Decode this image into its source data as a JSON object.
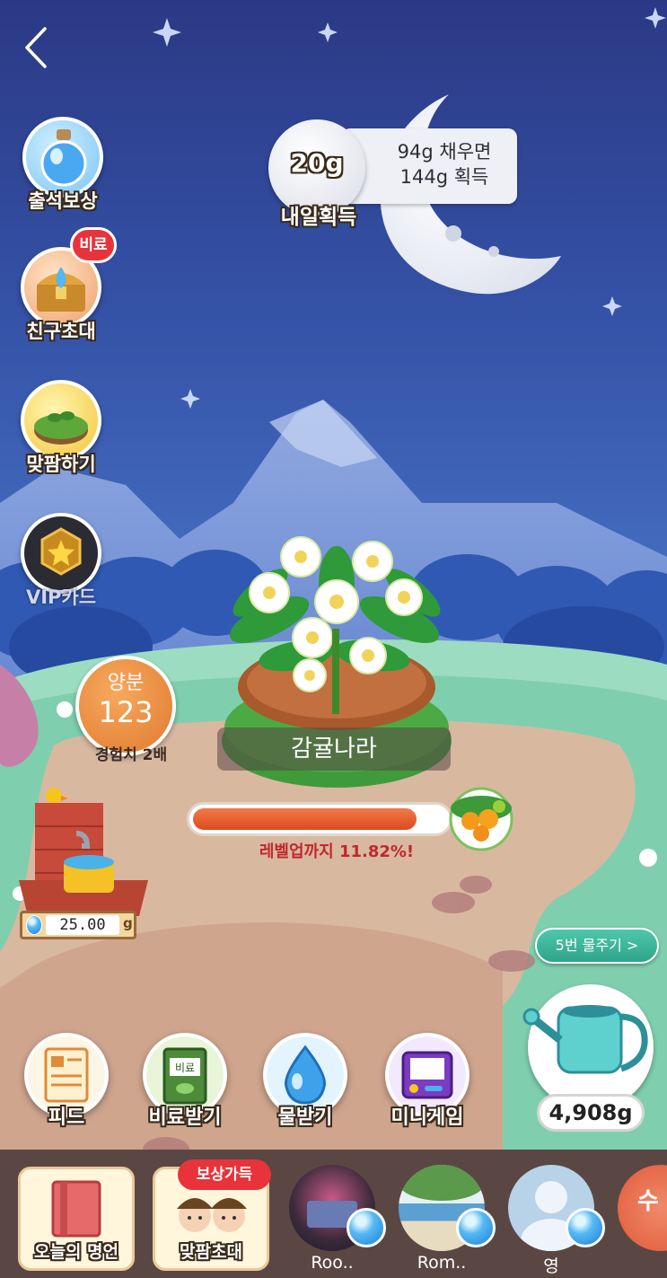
{
  "header": {
    "back_icon": "chevron-left-icon"
  },
  "reward": {
    "tomorrow_amount": "20g",
    "tomorrow_label": "내일획득",
    "bonus_line1": "94g 채우면",
    "bonus_line2": "144g 획득"
  },
  "side_menu": [
    {
      "label": "출석보상",
      "icon": "potion-bottle-icon"
    },
    {
      "label": "친구초대",
      "icon": "treasure-chest-icon",
      "badge": "비료"
    },
    {
      "label": "맞팜하기",
      "icon": "farm-plot-icon"
    },
    {
      "label": "VIP카드",
      "icon": "star-badge-icon"
    }
  ],
  "nutrient": {
    "title": "양분",
    "value": "123",
    "sub": "경험치 2배"
  },
  "plant": {
    "name": "감귤나라",
    "progress_text": "레벨업까지 11.82%!",
    "progress_fraction": 0.8818
  },
  "water_tank": {
    "amount": "25.00",
    "unit": "g"
  },
  "watering": {
    "button_label": "5번 물주기 >",
    "amount": "4,908g"
  },
  "bottom_actions": [
    {
      "label": "피드",
      "icon": "feed-document-icon"
    },
    {
      "label": "비료받기",
      "icon": "fertilizer-bag-icon",
      "bag_text": "비료"
    },
    {
      "label": "물받기",
      "icon": "water-drop-icon"
    },
    {
      "label": "미니게임",
      "icon": "game-console-icon"
    }
  ],
  "nav": [
    {
      "label": "오늘의 명언",
      "icon": "book-icon"
    },
    {
      "label": "맞팜초대",
      "icon": "kids-icon",
      "badge": "보상가득"
    },
    {
      "label": "Roo..",
      "icon": "friend-avatar"
    },
    {
      "label": "Rom..",
      "icon": "friend-avatar"
    },
    {
      "label": "영",
      "icon": "default-avatar"
    },
    {
      "label": "수",
      "icon": "friend-avatar"
    }
  ],
  "colors": {
    "sky_top": "#2c3a86",
    "sky_bottom": "#3e63b6",
    "progress": "#e8532a",
    "progress_text": "#c0282a",
    "nutrient_orange": "#ee8a3c",
    "water_button": "#39b59a"
  }
}
